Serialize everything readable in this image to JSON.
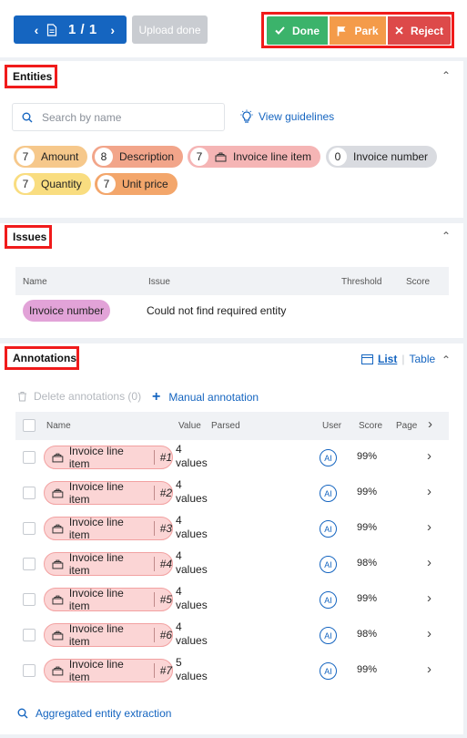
{
  "toolbar": {
    "page_indicator": "1 / 1",
    "upload_label": "Upload done",
    "done_label": "Done",
    "park_label": "Park",
    "reject_label": "Reject"
  },
  "entities": {
    "title": "Entities",
    "search_placeholder": "Search by name",
    "guidelines_label": "View guidelines",
    "chips": [
      {
        "count": "7",
        "label": "Amount",
        "color": "#f6c88b"
      },
      {
        "count": "8",
        "label": "Description",
        "color": "#f2a58a"
      },
      {
        "count": "7",
        "label": "Invoice line item",
        "color": "#f5b5b5"
      },
      {
        "count": "0",
        "label": "Invoice number",
        "color": "#d9dbe0"
      },
      {
        "count": "7",
        "label": "Quantity",
        "color": "#f9dd80"
      },
      {
        "count": "7",
        "label": "Unit price",
        "color": "#f3a66b"
      }
    ]
  },
  "issues": {
    "title": "Issues",
    "columns": [
      "Name",
      "Issue",
      "Threshold",
      "Score"
    ],
    "rows": [
      {
        "name": "Invoice number",
        "issue": "Could not find required entity",
        "threshold": "",
        "score": ""
      }
    ]
  },
  "annotations": {
    "title": "Annotations",
    "view_list": "List",
    "view_table": "Table",
    "delete_label": "Delete annotations (0)",
    "manual_label": "Manual annotation",
    "columns": [
      "Name",
      "Value",
      "Parsed",
      "User",
      "Score",
      "Page"
    ],
    "rows": [
      {
        "name": "Invoice line item",
        "index": "#1",
        "count": "4",
        "values": "values",
        "user": "AI",
        "score": "99%"
      },
      {
        "name": "Invoice line item",
        "index": "#2",
        "count": "4",
        "values": "values",
        "user": "AI",
        "score": "99%"
      },
      {
        "name": "Invoice line item",
        "index": "#3",
        "count": "4",
        "values": "values",
        "user": "AI",
        "score": "99%"
      },
      {
        "name": "Invoice line item",
        "index": "#4",
        "count": "4",
        "values": "values",
        "user": "AI",
        "score": "98%"
      },
      {
        "name": "Invoice line item",
        "index": "#5",
        "count": "4",
        "values": "values",
        "user": "AI",
        "score": "99%"
      },
      {
        "name": "Invoice line item",
        "index": "#6",
        "count": "4",
        "values": "values",
        "user": "AI",
        "score": "98%"
      },
      {
        "name": "Invoice line item",
        "index": "#7",
        "count": "5",
        "values": "values",
        "user": "AI",
        "score": "99%"
      }
    ],
    "aggregated_label": "Aggregated entity extraction"
  }
}
